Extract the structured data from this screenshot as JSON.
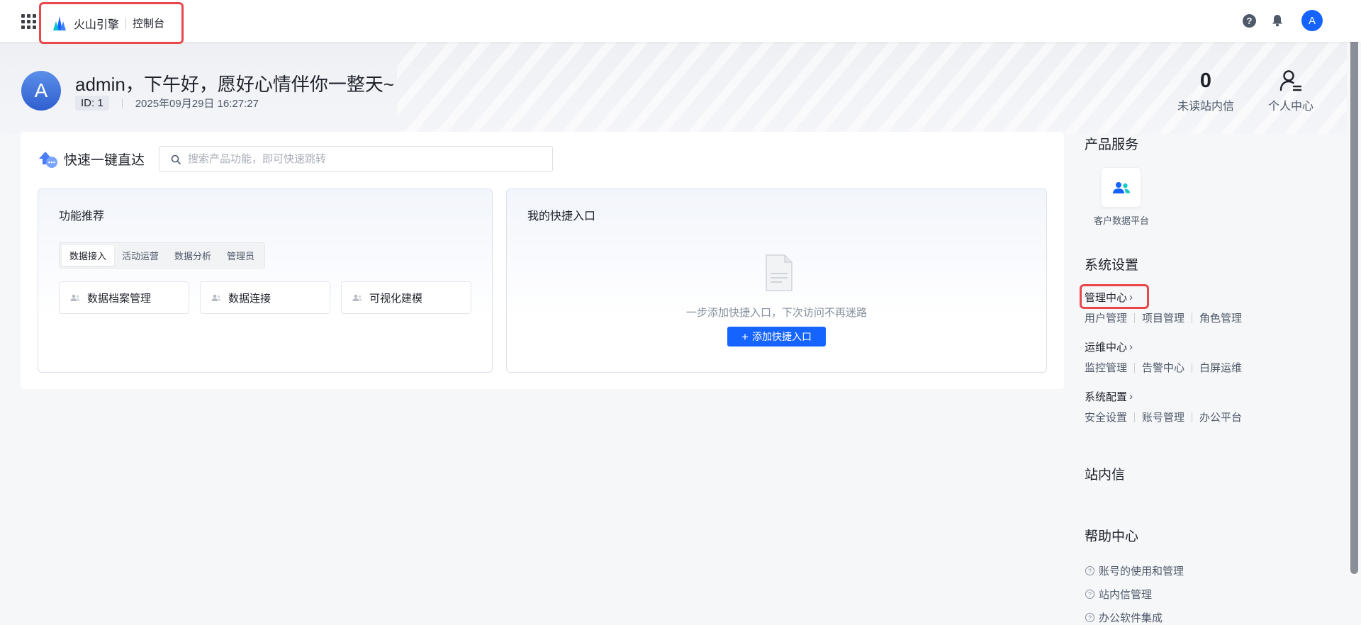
{
  "topbar": {
    "brand_name": "火山引擎",
    "console_label": "控制台",
    "help_glyph": "?",
    "avatar_letter": "A",
    "apps_icon": "grid-apps-icon",
    "bell_icon": "bell-icon"
  },
  "hero": {
    "avatar_letter": "A",
    "greeting": "admin，下午好，愿好心情伴你一整天~",
    "id_label": "ID: 1",
    "datetime": "2025年09月29日 16:27:27",
    "unread_count": "0",
    "unread_label": "未读站内信",
    "personal_center_label": "个人中心"
  },
  "quick_access": {
    "title": "快速一键直达",
    "search_placeholder": "搜索产品功能，即可快速跳转",
    "search_value": "",
    "recommend_title": "功能推荐",
    "tabs": [
      {
        "label": "数据接入",
        "active": true
      },
      {
        "label": "活动运营",
        "active": false
      },
      {
        "label": "数据分析",
        "active": false
      },
      {
        "label": "管理员",
        "active": false
      }
    ],
    "features": [
      {
        "label": "数据档案管理"
      },
      {
        "label": "数据连接"
      },
      {
        "label": "可视化建模"
      }
    ],
    "my_shortcuts_title": "我的快捷入口",
    "empty_text": "一步添加快捷入口，下次访问不再迷路",
    "add_button_label": "添加快捷入口",
    "add_button_glyph": "+"
  },
  "sidebar": {
    "product_services_title": "产品服务",
    "services": [
      {
        "label": "客户数据平台",
        "icon": "users-icon"
      }
    ],
    "system_settings_title": "系统设置",
    "groups": [
      {
        "title": "管理中心",
        "links": [
          "用户管理",
          "项目管理",
          "角色管理"
        ],
        "highlighted": true
      },
      {
        "title": "运维中心",
        "links": [
          "监控管理",
          "告警中心",
          "白屏运维"
        ],
        "highlighted": false
      },
      {
        "title": "系统配置",
        "links": [
          "安全设置",
          "账号管理",
          "办公平台"
        ],
        "highlighted": false
      }
    ],
    "chevron": "›",
    "messages_title": "站内信",
    "help_title": "帮助中心",
    "help_glyph": "?",
    "help_items": [
      "账号的使用和管理",
      "站内信管理",
      "办公软件集成"
    ]
  },
  "colors": {
    "primary": "#1664ff",
    "highlight": "#e8474b",
    "text": "#1d2129",
    "muted": "#4e5969"
  }
}
